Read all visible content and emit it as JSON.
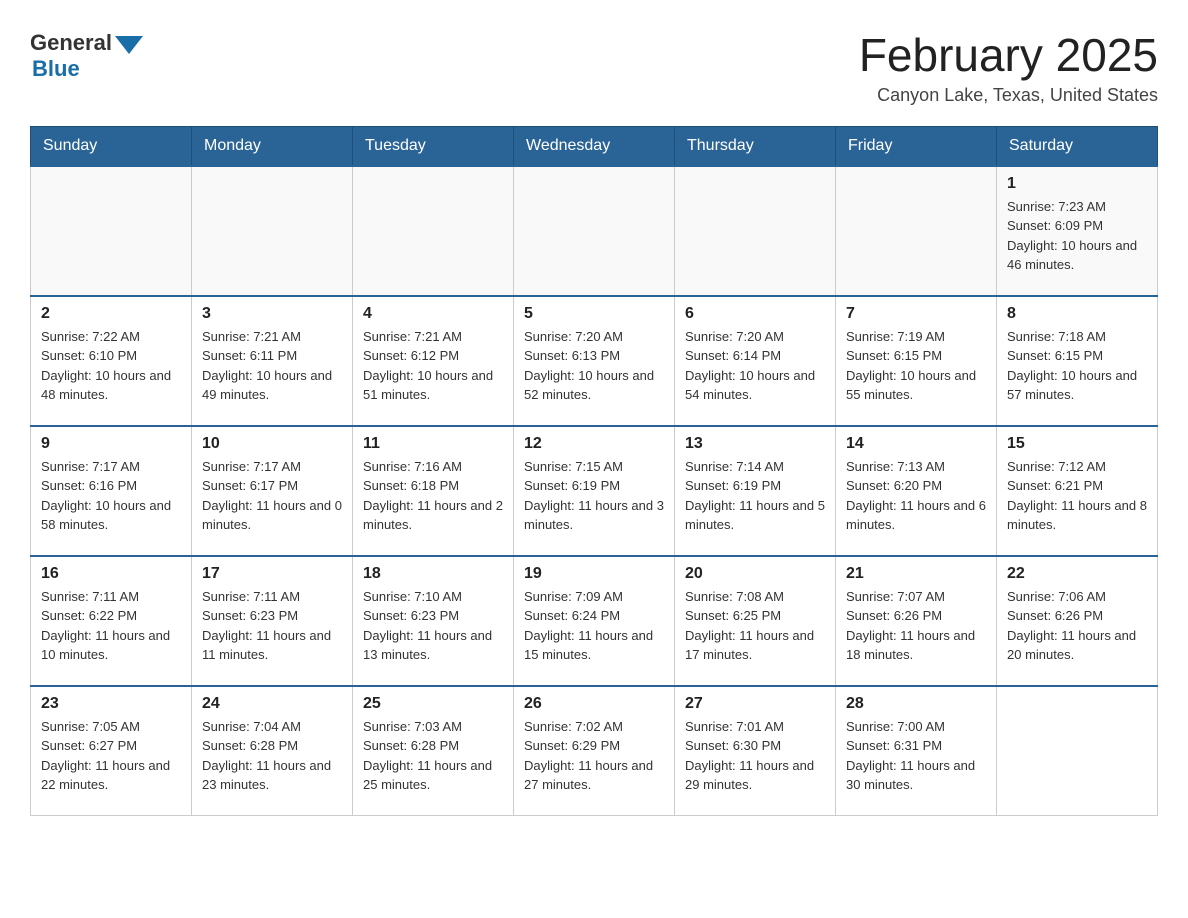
{
  "header": {
    "logo_general": "General",
    "logo_blue": "Blue",
    "title": "February 2025",
    "subtitle": "Canyon Lake, Texas, United States"
  },
  "weekdays": [
    "Sunday",
    "Monday",
    "Tuesday",
    "Wednesday",
    "Thursday",
    "Friday",
    "Saturday"
  ],
  "weeks": [
    [
      {
        "day": "",
        "sunrise": "",
        "sunset": "",
        "daylight": ""
      },
      {
        "day": "",
        "sunrise": "",
        "sunset": "",
        "daylight": ""
      },
      {
        "day": "",
        "sunrise": "",
        "sunset": "",
        "daylight": ""
      },
      {
        "day": "",
        "sunrise": "",
        "sunset": "",
        "daylight": ""
      },
      {
        "day": "",
        "sunrise": "",
        "sunset": "",
        "daylight": ""
      },
      {
        "day": "",
        "sunrise": "",
        "sunset": "",
        "daylight": ""
      },
      {
        "day": "1",
        "sunrise": "Sunrise: 7:23 AM",
        "sunset": "Sunset: 6:09 PM",
        "daylight": "Daylight: 10 hours and 46 minutes."
      }
    ],
    [
      {
        "day": "2",
        "sunrise": "Sunrise: 7:22 AM",
        "sunset": "Sunset: 6:10 PM",
        "daylight": "Daylight: 10 hours and 48 minutes."
      },
      {
        "day": "3",
        "sunrise": "Sunrise: 7:21 AM",
        "sunset": "Sunset: 6:11 PM",
        "daylight": "Daylight: 10 hours and 49 minutes."
      },
      {
        "day": "4",
        "sunrise": "Sunrise: 7:21 AM",
        "sunset": "Sunset: 6:12 PM",
        "daylight": "Daylight: 10 hours and 51 minutes."
      },
      {
        "day": "5",
        "sunrise": "Sunrise: 7:20 AM",
        "sunset": "Sunset: 6:13 PM",
        "daylight": "Daylight: 10 hours and 52 minutes."
      },
      {
        "day": "6",
        "sunrise": "Sunrise: 7:20 AM",
        "sunset": "Sunset: 6:14 PM",
        "daylight": "Daylight: 10 hours and 54 minutes."
      },
      {
        "day": "7",
        "sunrise": "Sunrise: 7:19 AM",
        "sunset": "Sunset: 6:15 PM",
        "daylight": "Daylight: 10 hours and 55 minutes."
      },
      {
        "day": "8",
        "sunrise": "Sunrise: 7:18 AM",
        "sunset": "Sunset: 6:15 PM",
        "daylight": "Daylight: 10 hours and 57 minutes."
      }
    ],
    [
      {
        "day": "9",
        "sunrise": "Sunrise: 7:17 AM",
        "sunset": "Sunset: 6:16 PM",
        "daylight": "Daylight: 10 hours and 58 minutes."
      },
      {
        "day": "10",
        "sunrise": "Sunrise: 7:17 AM",
        "sunset": "Sunset: 6:17 PM",
        "daylight": "Daylight: 11 hours and 0 minutes."
      },
      {
        "day": "11",
        "sunrise": "Sunrise: 7:16 AM",
        "sunset": "Sunset: 6:18 PM",
        "daylight": "Daylight: 11 hours and 2 minutes."
      },
      {
        "day": "12",
        "sunrise": "Sunrise: 7:15 AM",
        "sunset": "Sunset: 6:19 PM",
        "daylight": "Daylight: 11 hours and 3 minutes."
      },
      {
        "day": "13",
        "sunrise": "Sunrise: 7:14 AM",
        "sunset": "Sunset: 6:19 PM",
        "daylight": "Daylight: 11 hours and 5 minutes."
      },
      {
        "day": "14",
        "sunrise": "Sunrise: 7:13 AM",
        "sunset": "Sunset: 6:20 PM",
        "daylight": "Daylight: 11 hours and 6 minutes."
      },
      {
        "day": "15",
        "sunrise": "Sunrise: 7:12 AM",
        "sunset": "Sunset: 6:21 PM",
        "daylight": "Daylight: 11 hours and 8 minutes."
      }
    ],
    [
      {
        "day": "16",
        "sunrise": "Sunrise: 7:11 AM",
        "sunset": "Sunset: 6:22 PM",
        "daylight": "Daylight: 11 hours and 10 minutes."
      },
      {
        "day": "17",
        "sunrise": "Sunrise: 7:11 AM",
        "sunset": "Sunset: 6:23 PM",
        "daylight": "Daylight: 11 hours and 11 minutes."
      },
      {
        "day": "18",
        "sunrise": "Sunrise: 7:10 AM",
        "sunset": "Sunset: 6:23 PM",
        "daylight": "Daylight: 11 hours and 13 minutes."
      },
      {
        "day": "19",
        "sunrise": "Sunrise: 7:09 AM",
        "sunset": "Sunset: 6:24 PM",
        "daylight": "Daylight: 11 hours and 15 minutes."
      },
      {
        "day": "20",
        "sunrise": "Sunrise: 7:08 AM",
        "sunset": "Sunset: 6:25 PM",
        "daylight": "Daylight: 11 hours and 17 minutes."
      },
      {
        "day": "21",
        "sunrise": "Sunrise: 7:07 AM",
        "sunset": "Sunset: 6:26 PM",
        "daylight": "Daylight: 11 hours and 18 minutes."
      },
      {
        "day": "22",
        "sunrise": "Sunrise: 7:06 AM",
        "sunset": "Sunset: 6:26 PM",
        "daylight": "Daylight: 11 hours and 20 minutes."
      }
    ],
    [
      {
        "day": "23",
        "sunrise": "Sunrise: 7:05 AM",
        "sunset": "Sunset: 6:27 PM",
        "daylight": "Daylight: 11 hours and 22 minutes."
      },
      {
        "day": "24",
        "sunrise": "Sunrise: 7:04 AM",
        "sunset": "Sunset: 6:28 PM",
        "daylight": "Daylight: 11 hours and 23 minutes."
      },
      {
        "day": "25",
        "sunrise": "Sunrise: 7:03 AM",
        "sunset": "Sunset: 6:28 PM",
        "daylight": "Daylight: 11 hours and 25 minutes."
      },
      {
        "day": "26",
        "sunrise": "Sunrise: 7:02 AM",
        "sunset": "Sunset: 6:29 PM",
        "daylight": "Daylight: 11 hours and 27 minutes."
      },
      {
        "day": "27",
        "sunrise": "Sunrise: 7:01 AM",
        "sunset": "Sunset: 6:30 PM",
        "daylight": "Daylight: 11 hours and 29 minutes."
      },
      {
        "day": "28",
        "sunrise": "Sunrise: 7:00 AM",
        "sunset": "Sunset: 6:31 PM",
        "daylight": "Daylight: 11 hours and 30 minutes."
      },
      {
        "day": "",
        "sunrise": "",
        "sunset": "",
        "daylight": ""
      }
    ]
  ]
}
